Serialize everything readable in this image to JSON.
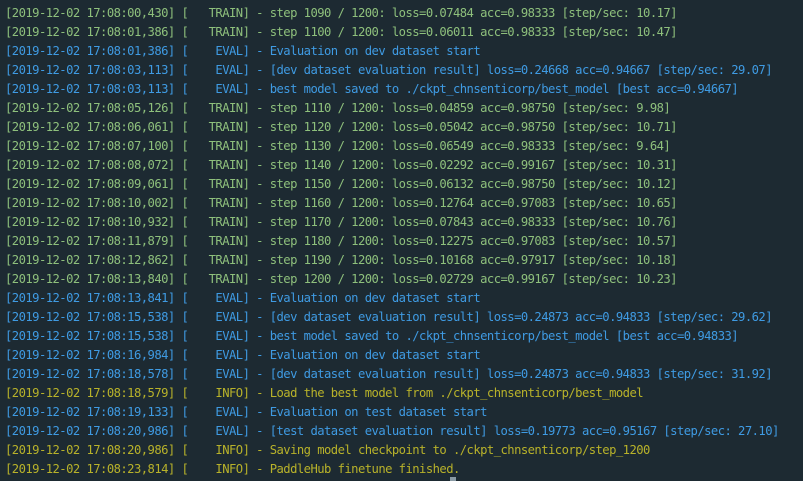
{
  "terminal": {
    "lines": [
      {
        "level": "TRAIN",
        "text": "[2019-12-02 17:08:00,430] [   TRAIN] - step 1090 / 1200: loss=0.07484 acc=0.98333 [step/sec: 10.17]"
      },
      {
        "level": "TRAIN",
        "text": "[2019-12-02 17:08:01,386] [   TRAIN] - step 1100 / 1200: loss=0.06011 acc=0.98333 [step/sec: 10.47]"
      },
      {
        "level": "EVAL",
        "text": "[2019-12-02 17:08:01,386] [    EVAL] - Evaluation on dev dataset start"
      },
      {
        "level": "EVAL",
        "text": "[2019-12-02 17:08:03,113] [    EVAL] - [dev dataset evaluation result] loss=0.24668 acc=0.94667 [step/sec: 29.07]"
      },
      {
        "level": "EVAL",
        "text": "[2019-12-02 17:08:03,113] [    EVAL] - best model saved to ./ckpt_chnsenticorp/best_model [best acc=0.94667]"
      },
      {
        "level": "TRAIN",
        "text": "[2019-12-02 17:08:05,126] [   TRAIN] - step 1110 / 1200: loss=0.04859 acc=0.98750 [step/sec: 9.98]"
      },
      {
        "level": "TRAIN",
        "text": "[2019-12-02 17:08:06,061] [   TRAIN] - step 1120 / 1200: loss=0.05042 acc=0.98750 [step/sec: 10.71]"
      },
      {
        "level": "TRAIN",
        "text": "[2019-12-02 17:08:07,100] [   TRAIN] - step 1130 / 1200: loss=0.06549 acc=0.98333 [step/sec: 9.64]"
      },
      {
        "level": "TRAIN",
        "text": "[2019-12-02 17:08:08,072] [   TRAIN] - step 1140 / 1200: loss=0.02292 acc=0.99167 [step/sec: 10.31]"
      },
      {
        "level": "TRAIN",
        "text": "[2019-12-02 17:08:09,061] [   TRAIN] - step 1150 / 1200: loss=0.06132 acc=0.98750 [step/sec: 10.12]"
      },
      {
        "level": "TRAIN",
        "text": "[2019-12-02 17:08:10,002] [   TRAIN] - step 1160 / 1200: loss=0.12764 acc=0.97083 [step/sec: 10.65]"
      },
      {
        "level": "TRAIN",
        "text": "[2019-12-02 17:08:10,932] [   TRAIN] - step 1170 / 1200: loss=0.07843 acc=0.98333 [step/sec: 10.76]"
      },
      {
        "level": "TRAIN",
        "text": "[2019-12-02 17:08:11,879] [   TRAIN] - step 1180 / 1200: loss=0.12275 acc=0.97083 [step/sec: 10.57]"
      },
      {
        "level": "TRAIN",
        "text": "[2019-12-02 17:08:12,862] [   TRAIN] - step 1190 / 1200: loss=0.10168 acc=0.97917 [step/sec: 10.18]"
      },
      {
        "level": "TRAIN",
        "text": "[2019-12-02 17:08:13,840] [   TRAIN] - step 1200 / 1200: loss=0.02729 acc=0.99167 [step/sec: 10.23]"
      },
      {
        "level": "EVAL",
        "text": "[2019-12-02 17:08:13,841] [    EVAL] - Evaluation on dev dataset start"
      },
      {
        "level": "EVAL",
        "text": "[2019-12-02 17:08:15,538] [    EVAL] - [dev dataset evaluation result] loss=0.24873 acc=0.94833 [step/sec: 29.62]"
      },
      {
        "level": "EVAL",
        "text": "[2019-12-02 17:08:15,538] [    EVAL] - best model saved to ./ckpt_chnsenticorp/best_model [best acc=0.94833]"
      },
      {
        "level": "EVAL",
        "text": "[2019-12-02 17:08:16,984] [    EVAL] - Evaluation on dev dataset start"
      },
      {
        "level": "EVAL",
        "text": "[2019-12-02 17:08:18,578] [    EVAL] - [dev dataset evaluation result] loss=0.24873 acc=0.94833 [step/sec: 31.92]"
      },
      {
        "level": "INFO",
        "text": "[2019-12-02 17:08:18,579] [    INFO] - Load the best model from ./ckpt_chnsenticorp/best_model"
      },
      {
        "level": "EVAL",
        "text": "[2019-12-02 17:08:19,133] [    EVAL] - Evaluation on test dataset start"
      },
      {
        "level": "EVAL",
        "text": "[2019-12-02 17:08:20,986] [    EVAL] - [test dataset evaluation result] loss=0.19773 acc=0.95167 [step/sec: 27.10]"
      },
      {
        "level": "INFO",
        "text": "[2019-12-02 17:08:20,986] [    INFO] - Saving model checkpoint to ./ckpt_chnsenticorp/step_1200"
      },
      {
        "level": "INFO",
        "text": "[2019-12-02 17:08:23,814] [    INFO] - PaddleHub finetune finished."
      }
    ]
  },
  "colors": {
    "background": "#1d2a32",
    "TRAIN": "#8ec07c",
    "EVAL": "#3f9be3",
    "INFO": "#b8b22a"
  }
}
